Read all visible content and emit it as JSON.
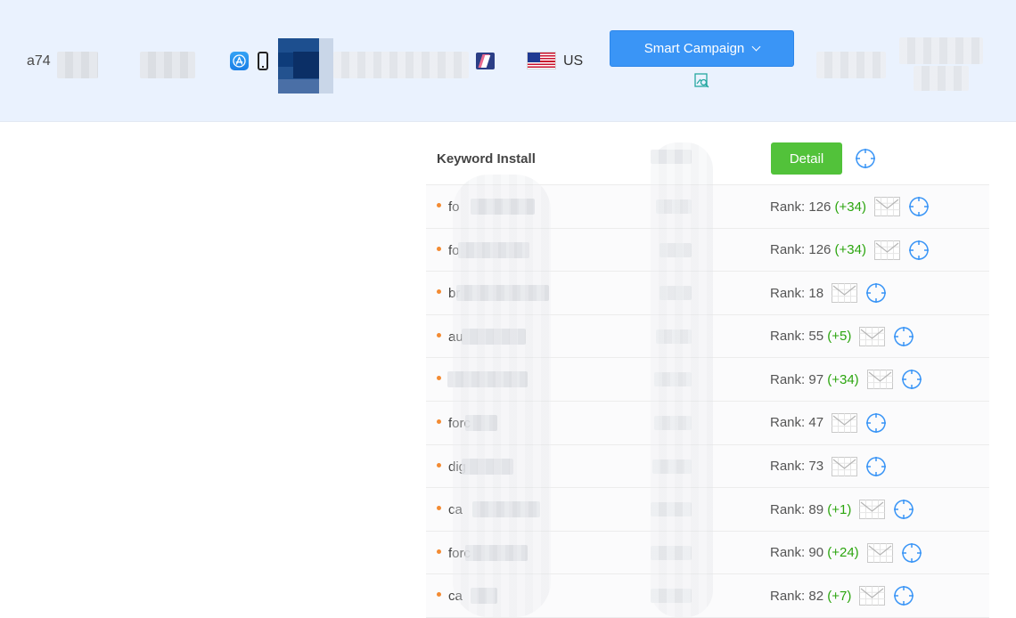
{
  "header": {
    "account_id": "a74",
    "country_code": "US",
    "campaign_button_label": "Smart Campaign",
    "icons": [
      "app-store-icon",
      "iphone-icon",
      "app-icon",
      "brand-icon",
      "us-flag-icon",
      "chevron-down-icon",
      "image-search-icon"
    ]
  },
  "table": {
    "title": "Keyword Install",
    "detail_label": "Detail",
    "rows": [
      {
        "keyword": "fo",
        "rank_text": "Rank: 126",
        "delta": "(+34)"
      },
      {
        "keyword": "fo",
        "rank_text": "Rank: 126",
        "delta": "(+34)"
      },
      {
        "keyword": "br",
        "rank_text": "Rank: 18",
        "delta": ""
      },
      {
        "keyword": "au",
        "rank_text": "Rank: 55",
        "delta": "(+5)"
      },
      {
        "keyword": "",
        "rank_text": "Rank: 97",
        "delta": "(+34)"
      },
      {
        "keyword": "forc",
        "rank_text": "Rank: 47",
        "delta": ""
      },
      {
        "keyword": "dig",
        "rank_text": "Rank: 73",
        "delta": ""
      },
      {
        "keyword": "ca",
        "rank_text": "Rank: 89",
        "delta": "(+1)"
      },
      {
        "keyword": "forc",
        "rank_text": "Rank: 90",
        "delta": "(+24)"
      },
      {
        "keyword": "ca",
        "rank_text": "Rank: 82",
        "delta": "(+7)"
      }
    ]
  },
  "colors": {
    "header_bg": "#eaf2fe",
    "primary_button": "#3a95f6",
    "detail_button": "#52c23a",
    "delta_green": "#2ba50e",
    "bullet_orange": "#f38b33",
    "target_blue": "#3a95f6"
  }
}
